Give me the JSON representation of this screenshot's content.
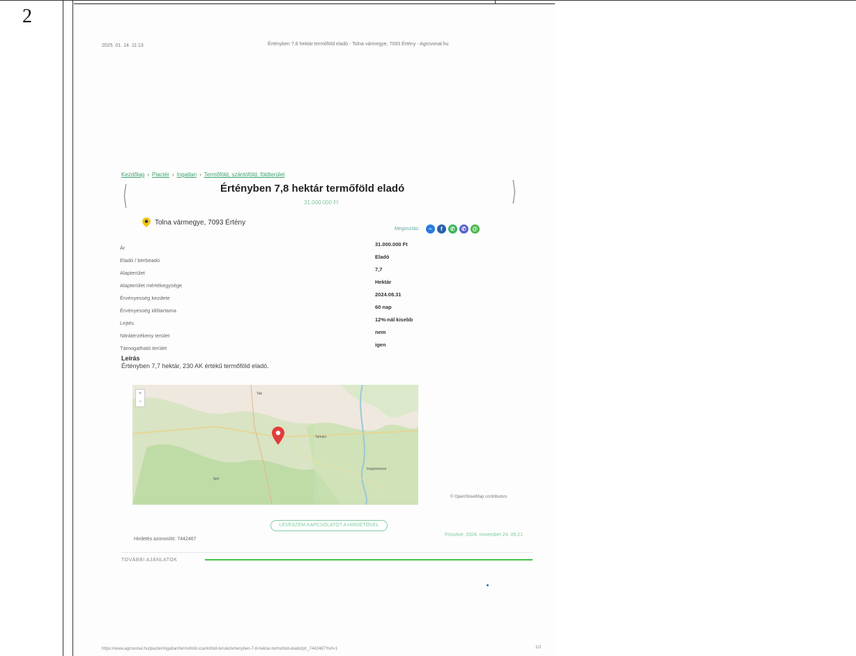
{
  "row_number": "2",
  "print_header": {
    "date": "2025. 01. 14. 11:13",
    "title": "Értényben 7,8 hektár termőföld eladó - Tolna vármegye, 7093 Értény - Agrovonal.hu"
  },
  "breadcrumb": [
    "Kezdőlap",
    "Piactér",
    "Ingatlan",
    "Termőföld, szántóföld, földterület"
  ],
  "listing": {
    "title": "Értényben 7,8 hektár termőföld eladó",
    "price": "31.000.000 Ft",
    "location": "Tolna vármegye, 7093 Értény"
  },
  "share": {
    "label": "Megosztás:",
    "buttons": [
      {
        "name": "messenger",
        "glyph": "~",
        "color": "#2b7be0"
      },
      {
        "name": "facebook",
        "glyph": "f",
        "color": "#2b5fa8"
      },
      {
        "name": "whatsapp",
        "glyph": "✆",
        "color": "#3bb55a"
      },
      {
        "name": "viber",
        "glyph": "✆",
        "color": "#5a64c8"
      },
      {
        "name": "email",
        "glyph": "@",
        "color": "#48b848"
      }
    ]
  },
  "details": [
    {
      "label": "Ár",
      "value": "31.000.000 Ft"
    },
    {
      "label": "Eladó / bérbeadó",
      "value": "Eladó"
    },
    {
      "label": "Alapterület",
      "value": "7,7"
    },
    {
      "label": "Alapterület mértékegysége",
      "value": "Hektár"
    },
    {
      "label": "Érvényesség kezdete",
      "value": "2024.08.31"
    },
    {
      "label": "Érvényesség időtartama",
      "value": "60 nap"
    },
    {
      "label": "Lejtés",
      "value": "12%-nál kisebb"
    },
    {
      "label": "Nitrátérzékeny terület",
      "value": "nem"
    },
    {
      "label": "Támogatható terület",
      "value": "igen"
    }
  ],
  "description": {
    "heading": "Leírás",
    "text": "Értényben 7,7 hektár, 230 AK értékű termőföld eladó."
  },
  "map": {
    "labels": [
      "Tab",
      "Tamási",
      "Iregszemcse",
      "Igal"
    ],
    "credit": "© OpenStreetMap contributors"
  },
  "contact_button": "LEVESZEM KAPCSOLATOT A HIRDETŐVEL",
  "ad_id": "Hirdetés azonosító: 7442467",
  "updated": "Frissítve: 2024. november 24. 06:21",
  "more_offers": "TOVÁBBI AJÁNLATOK",
  "print_footer": {
    "url": "https://www.agrovonal.hu/piacter/ingatlan/termofold-szantofold-terulet/ertenyben-7-8-hektar-termofold-elado/ptr_7442467?ref=1",
    "page": "1/2"
  }
}
